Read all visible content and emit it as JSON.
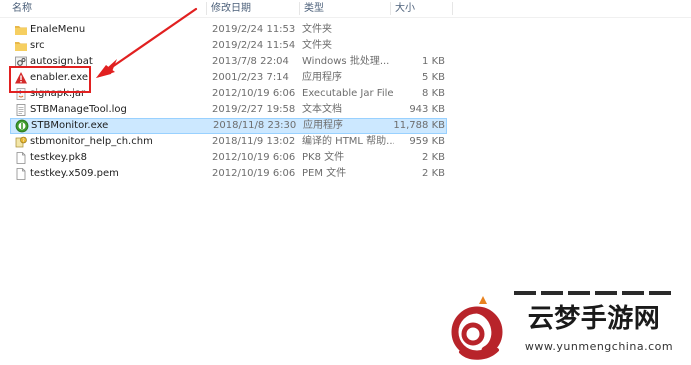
{
  "columns": {
    "name": "名称",
    "date": "修改日期",
    "type": "类型",
    "size": "大小"
  },
  "files": [
    {
      "name": "EnaleMenu",
      "date": "2019/2/24 11:53",
      "type": "文件夹",
      "size": "",
      "icon": "folder-icon"
    },
    {
      "name": "src",
      "date": "2019/2/24 11:54",
      "type": "文件夹",
      "size": "",
      "icon": "folder-icon"
    },
    {
      "name": "autosign.bat",
      "date": "2013/7/8 22:04",
      "type": "Windows 批处理...",
      "size": "1 KB",
      "icon": "batch-file-icon"
    },
    {
      "name": "enabler.exe",
      "date": "2001/2/23 7:14",
      "type": "应用程序",
      "size": "5 KB",
      "icon": "warning-exe-icon"
    },
    {
      "name": "signapk.jar",
      "date": "2012/10/19 6:06",
      "type": "Executable Jar File",
      "size": "8 KB",
      "icon": "jar-file-icon"
    },
    {
      "name": "STBManageTool.log",
      "date": "2019/2/27 19:58",
      "type": "文本文档",
      "size": "943 KB",
      "icon": "text-file-icon"
    },
    {
      "name": "STBMonitor.exe",
      "date": "2018/11/8 23:30",
      "type": "应用程序",
      "size": "11,788 KB",
      "icon": "green-exe-icon"
    },
    {
      "name": "stbmonitor_help_ch.chm",
      "date": "2018/11/9 13:02",
      "type": "编译的 HTML 帮助...",
      "size": "959 KB",
      "icon": "help-file-icon"
    },
    {
      "name": "testkey.pk8",
      "date": "2012/10/19 6:06",
      "type": "PK8 文件",
      "size": "2 KB",
      "icon": "blank-file-icon"
    },
    {
      "name": "testkey.x509.pem",
      "date": "2012/10/19 6:06",
      "type": "PEM 文件",
      "size": "2 KB",
      "icon": "blank-file-icon"
    }
  ],
  "selected_row": "STBMonitor.exe",
  "annotation": {
    "color": "#e12020"
  },
  "watermark": {
    "title": "云梦手游网",
    "url": "www.yunmengchina.com"
  }
}
